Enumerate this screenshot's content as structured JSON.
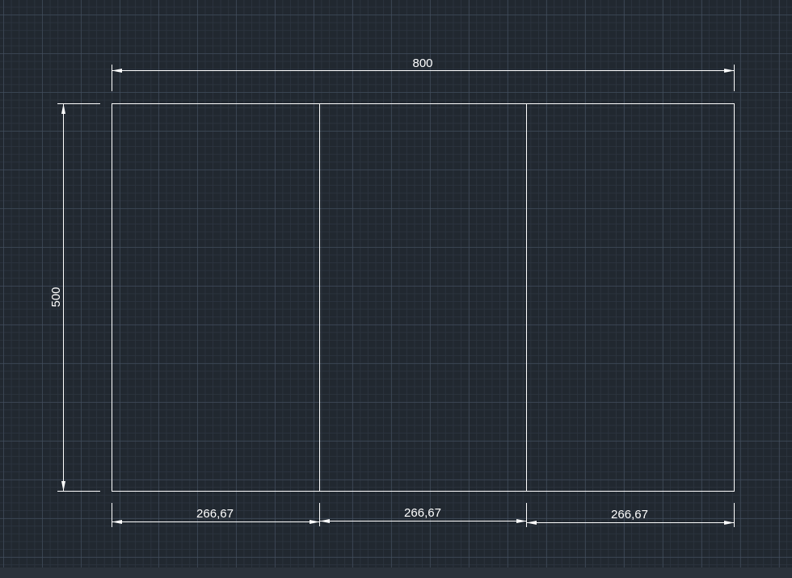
{
  "colors": {
    "background": "#212830",
    "grid_major": "#465262",
    "grid_minor": "#2c343f",
    "geometry": "#ffffff"
  },
  "drawing": {
    "overall_width": "800",
    "overall_height": "500",
    "segment_widths": [
      "266,67",
      "266,67",
      "266,67"
    ]
  }
}
